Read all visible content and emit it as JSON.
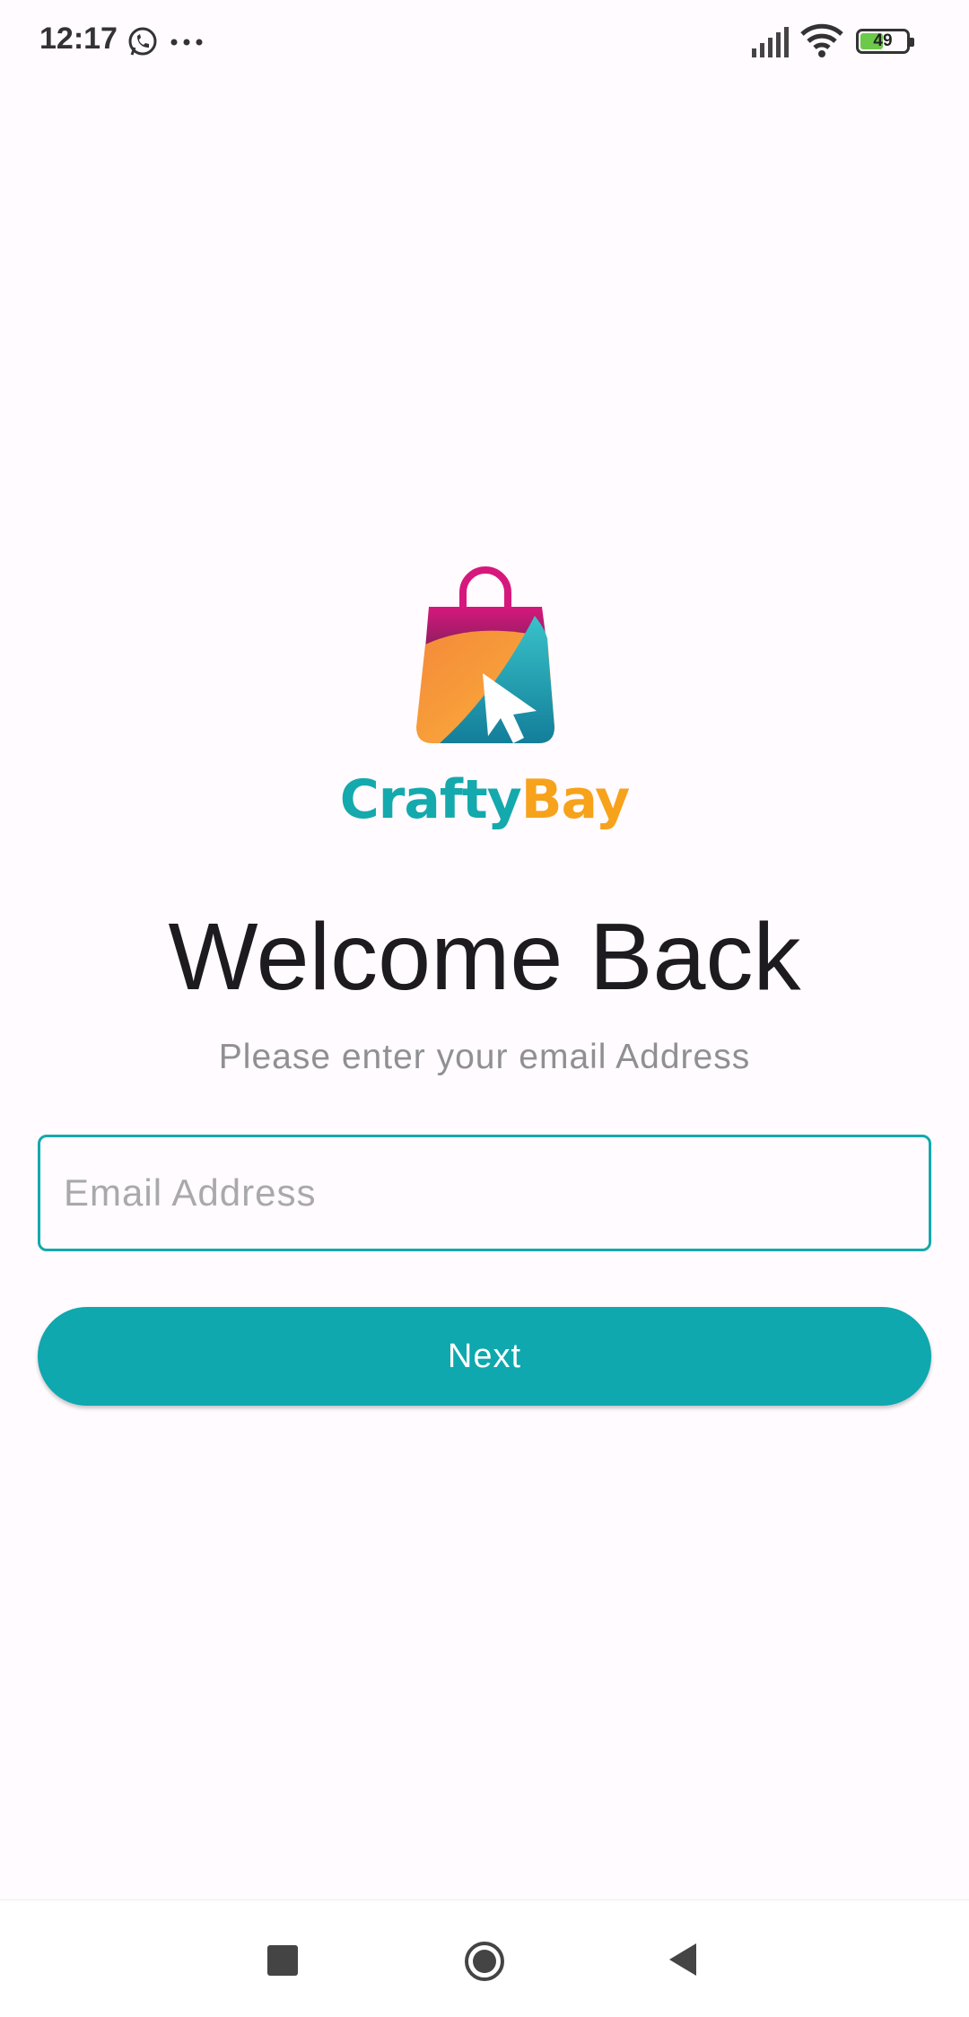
{
  "status_bar": {
    "time": "12:17",
    "battery": "49",
    "battery_level": 0.49,
    "icons": [
      "whatsapp-icon",
      "more-icon",
      "signal-icon",
      "wifi-icon",
      "battery-icon"
    ]
  },
  "logo": {
    "part1": "Crafty",
    "part2": "Bay",
    "colors": {
      "teal": "#14a9ad",
      "orange": "#f7a21b",
      "magenta": "#d11a7a"
    }
  },
  "login": {
    "title": "Welcome Back",
    "subtitle": "Please enter your email Address",
    "email_value": "",
    "email_placeholder": "Email Address",
    "next_label": "Next"
  },
  "nav_bar": {
    "icons": [
      "recents-icon",
      "home-icon",
      "back-icon"
    ]
  },
  "colors": {
    "accent": "#0ea8ae",
    "background": "#fffbfe",
    "title": "#1d1b20",
    "subtitle": "#8f8f94"
  }
}
